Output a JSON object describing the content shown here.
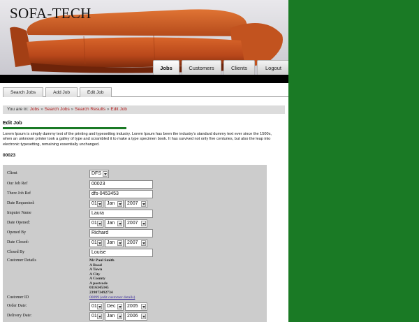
{
  "site": {
    "title": "SOFA-TECH"
  },
  "colors": {
    "page_background": "#1a7a25",
    "heading_rule": "#1a7a25",
    "breadcrumb_link": "#b11c1c",
    "sofa": "#c4541f"
  },
  "nav": {
    "items": [
      "Jobs",
      "Customers",
      "Clients",
      "Logout"
    ],
    "active": "Jobs"
  },
  "subtabs": [
    "Search Jobs",
    "Add Job",
    "Edit Job"
  ],
  "breadcrumb": {
    "prefix": "You are in:",
    "items": [
      "Jobs",
      "Search Jobs",
      "Search Results",
      "Edit Job"
    ],
    "separator": "»"
  },
  "section": {
    "heading": "Edit Job",
    "intro": "Lorem Ipsum is simply dummy text of the printing and typesetting industry. Lorem Ipsum has been the industry's standard dummy text ever since the 1500s, when an unknown printer took a galley of type and scrambled it to make a type specimen book. It has survived not only five centuries, but also the leap into electronic typesetting, remaining essentially unchanged.",
    "job_number": "00023"
  },
  "form": {
    "client": {
      "label": "Client",
      "value": "DFS"
    },
    "our_job_ref": {
      "label": "Our Job Ref",
      "value": "00023"
    },
    "there_job_ref": {
      "label": "There Job Ref",
      "value": "dfs-0453453"
    },
    "date_requested": {
      "label": "Date Requested:",
      "day": "01",
      "month": "Jan",
      "year": "2007"
    },
    "imputer_name": {
      "label": "Imputer Name",
      "value": "Laura"
    },
    "date_opened": {
      "label": "Date Opened:",
      "day": "01",
      "month": "Jan",
      "year": "2007"
    },
    "opened_by": {
      "label": "Opened By",
      "value": "Richard"
    },
    "date_closed": {
      "label": "Date Closed:",
      "day": "01",
      "month": "Jan",
      "year": "2007"
    },
    "closed_by": {
      "label": "Closed By",
      "value": "Louise"
    },
    "customer_details": {
      "label": "Customer Details",
      "lines": [
        "Mr Paul Smith",
        "A Road",
        "A Town",
        "A City",
        "A County",
        "A postcode",
        "0116345345",
        "239873492734"
      ]
    },
    "customer_id": {
      "label": "Customer ID",
      "link": "00099 (edit customer details)"
    },
    "order_date": {
      "label": "Order Date:",
      "day": "01",
      "month": "Dec",
      "year": "2005"
    },
    "delivery_date": {
      "label": "Delivery Date:",
      "day": "01",
      "month": "Jan",
      "year": "2006"
    }
  }
}
